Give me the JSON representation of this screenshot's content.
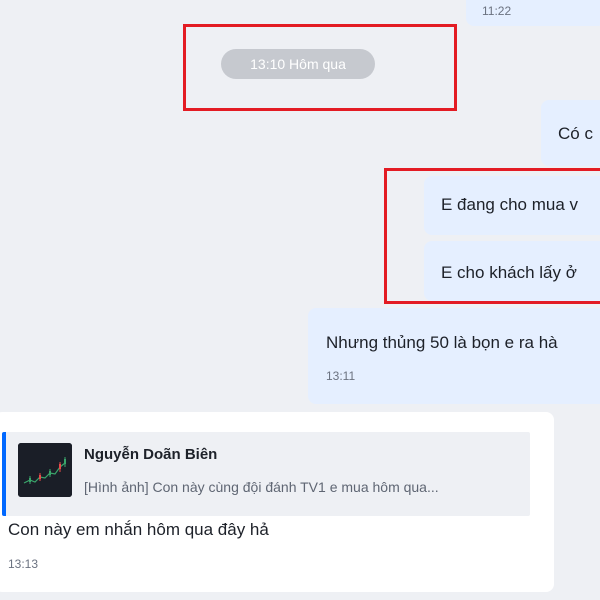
{
  "conversation": {
    "top_bubble_time": "11:22",
    "date_separator": "13:10 Hôm qua",
    "messages_out": [
      {
        "text": "Có c"
      },
      {
        "text": "E đang cho mua v"
      },
      {
        "text": "E cho khách lấy ở"
      },
      {
        "text": "Nhưng thủng 50 là bọn e ra hà",
        "time": "13:11"
      }
    ],
    "reply_message": {
      "quoted_name": "Nguyễn Doãn Biên",
      "quoted_text": "[Hình ảnh] Con này cùng đội đánh TV1 e mua hôm qua...",
      "quoted_image_icon": "candlestick-chart-thumbnail",
      "text": "Con này em nhắn hôm qua đây hả",
      "time": "13:13"
    }
  },
  "annotation": {
    "color": "#e31b23"
  },
  "colors": {
    "outgoing_bubble": "#e5efff",
    "incoming_bubble": "#ffffff",
    "background": "#eef0f4",
    "quote_accent": "#0068ff"
  }
}
